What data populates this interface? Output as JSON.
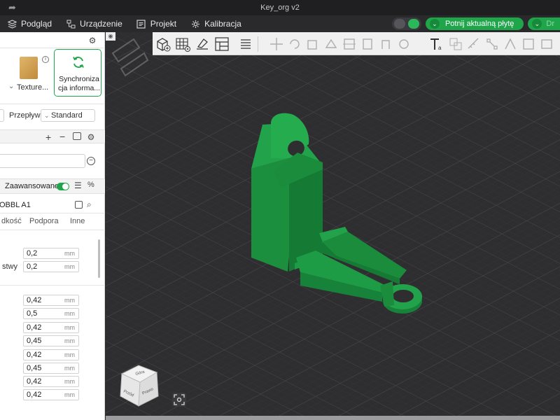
{
  "window": {
    "title": "Key_org v2"
  },
  "menu": {
    "items": [
      {
        "label": "Podgląd",
        "icon": "cube-stack-icon"
      },
      {
        "label": "Urządzenie",
        "icon": "device-icon"
      },
      {
        "label": "Projekt",
        "icon": "project-icon"
      },
      {
        "label": "Kalibracja",
        "icon": "calibration-icon"
      }
    ],
    "slice_button_label": "Potnij aktualną płytę",
    "print_button_label": "Dr"
  },
  "filament": {
    "texture_label": "Texture...",
    "sync_label": "Synchroniza cja informa..."
  },
  "flow": {
    "label": "Przepływ",
    "value": "Standard"
  },
  "process": {
    "advanced_label": "Zaawansowane",
    "advanced_on": true,
    "printer_preset": "OBBL A1",
    "tabs": [
      "dkość",
      "Podpora",
      "Inne"
    ]
  },
  "layer_fields": [
    {
      "label": "",
      "value": "0,2",
      "unit": "mm"
    },
    {
      "label": "stwy",
      "value": "0,2",
      "unit": "mm"
    }
  ],
  "line_width_fields": [
    {
      "value": "0,42",
      "unit": "mm"
    },
    {
      "value": "0,5",
      "unit": "mm"
    },
    {
      "value": "0,42",
      "unit": "mm"
    },
    {
      "value": "0,45",
      "unit": "mm"
    },
    {
      "value": "0,42",
      "unit": "mm"
    },
    {
      "value": "0,45",
      "unit": "mm"
    },
    {
      "value": "0,42",
      "unit": "mm"
    },
    {
      "value": "0,42",
      "unit": "mm"
    }
  ],
  "navcube": {
    "top": "Góra",
    "front": "Przód",
    "right": "Prawo"
  },
  "colors": {
    "accent": "#1fa64a",
    "model": "#1e9c45",
    "viewport_bg": "#2e2e31"
  }
}
